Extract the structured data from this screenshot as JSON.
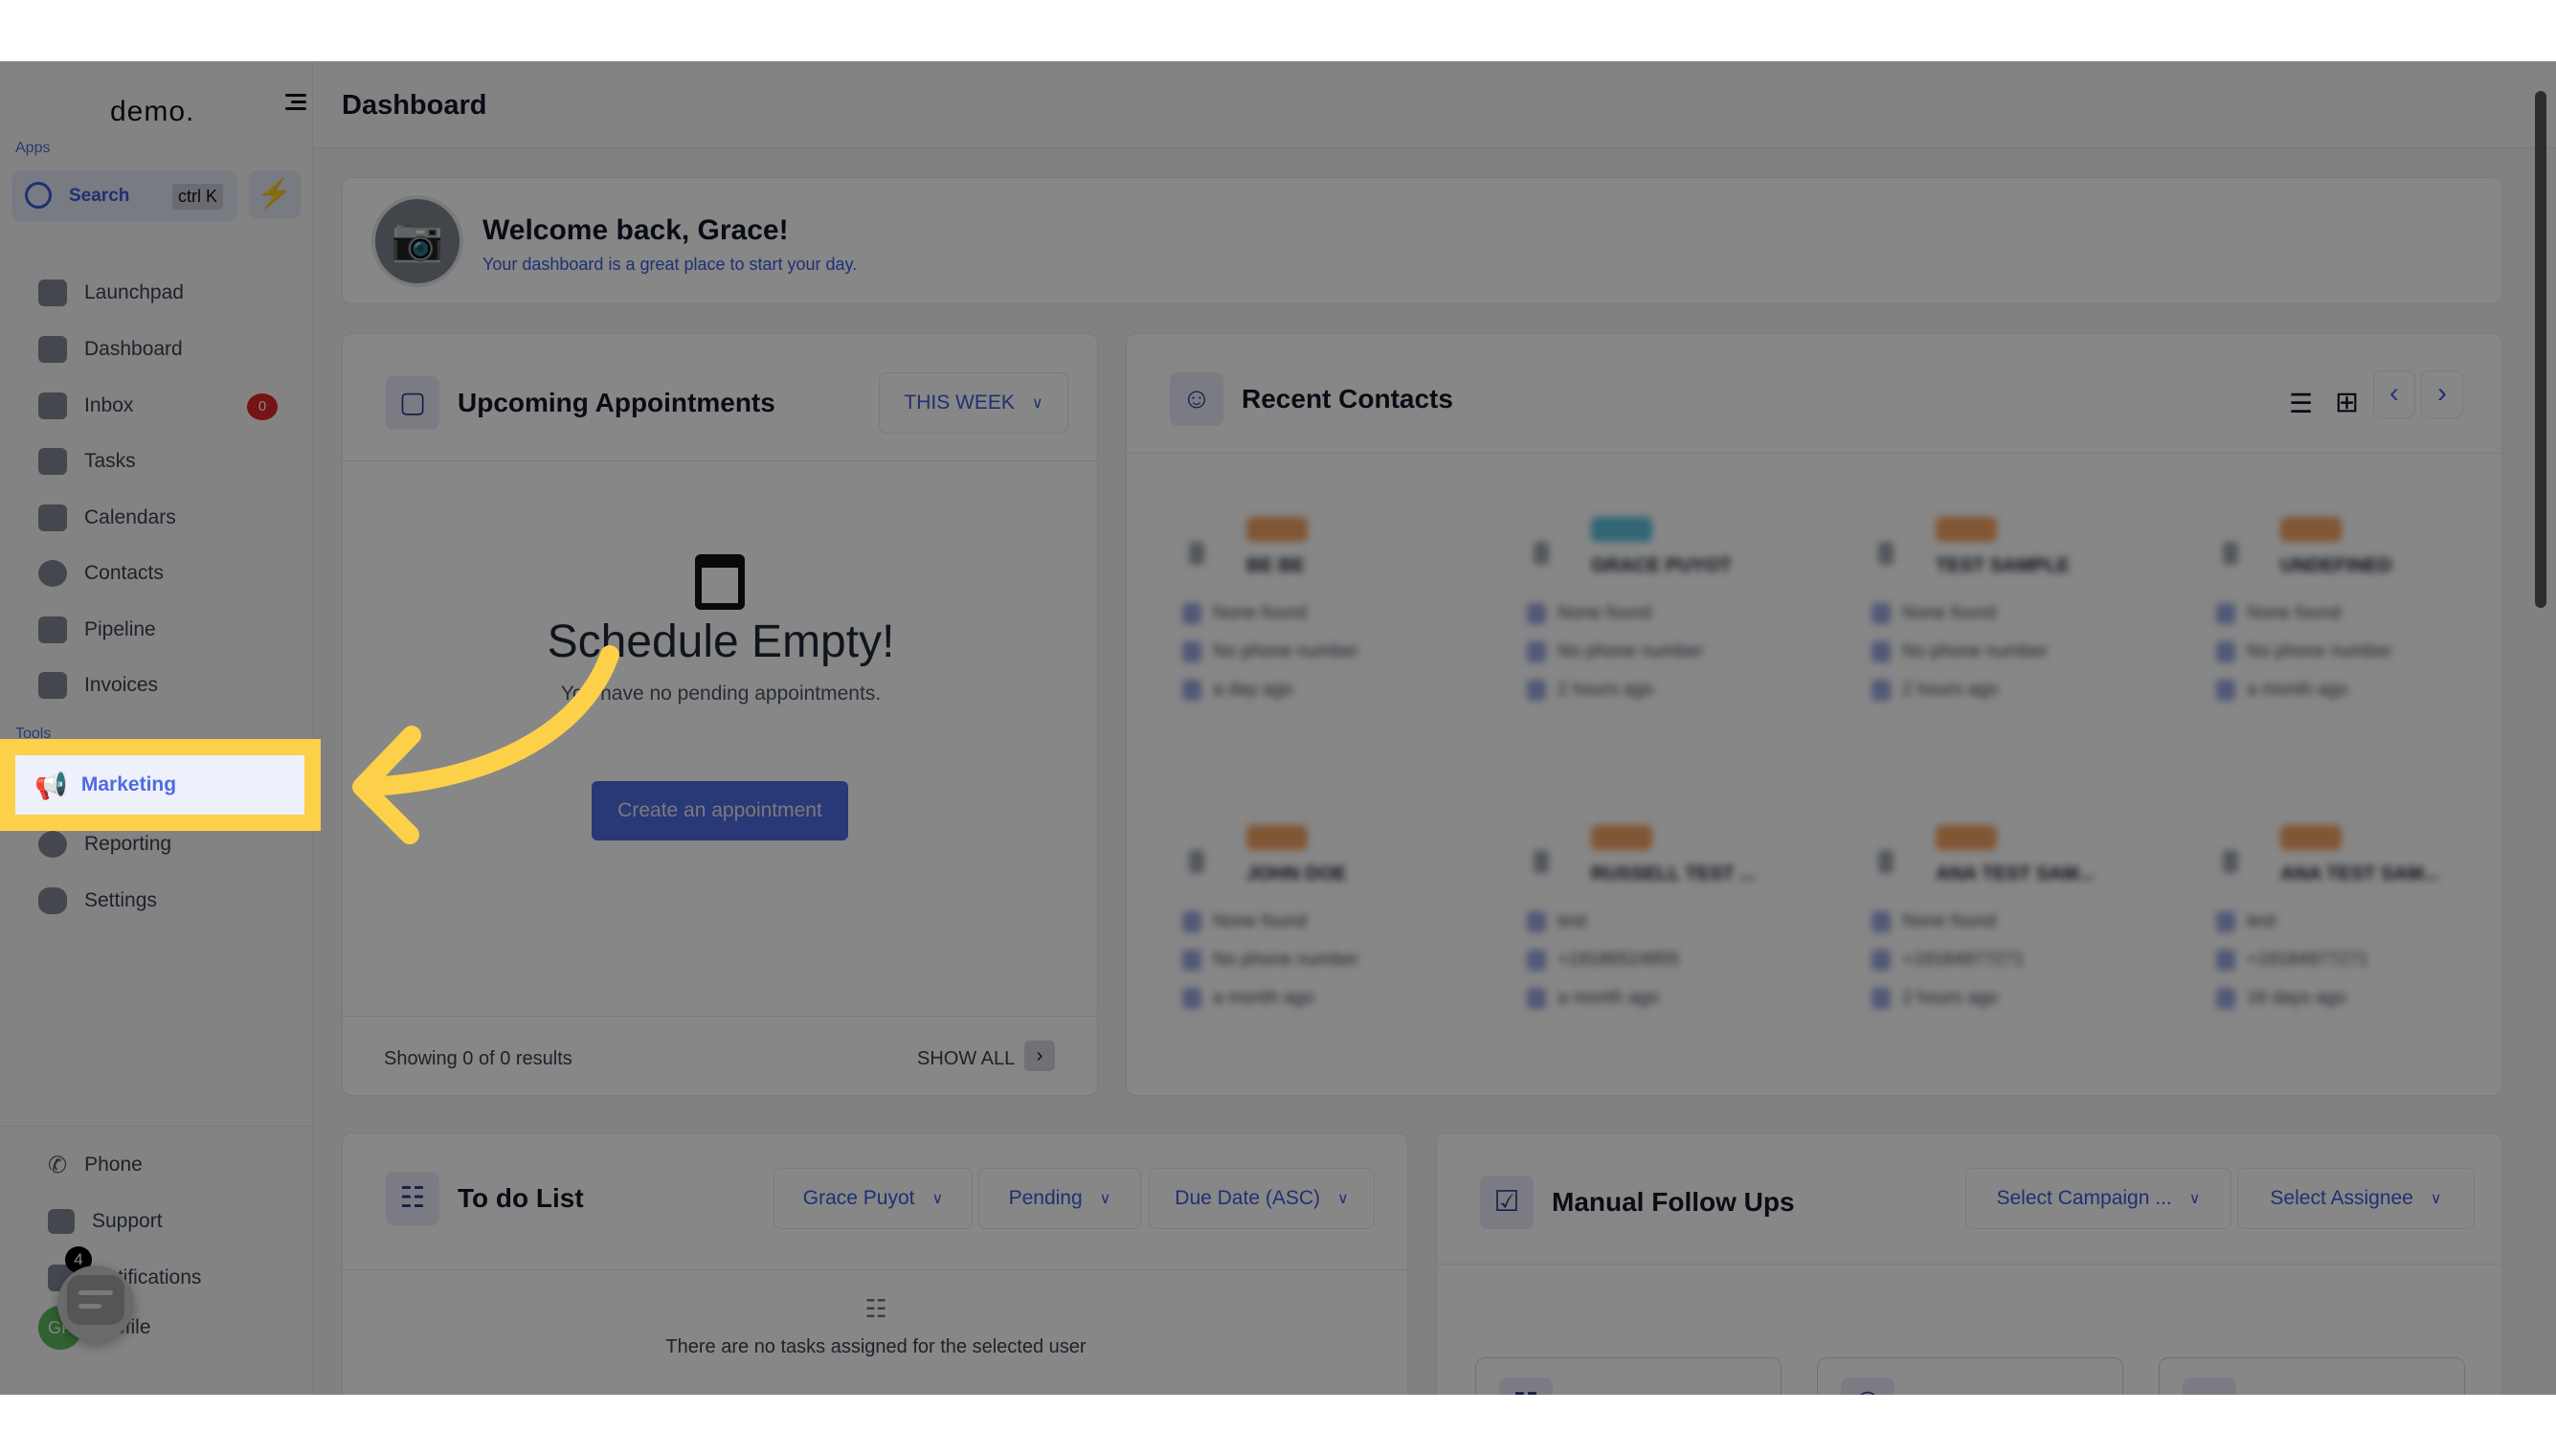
{
  "sidebar": {
    "logo": "demo.",
    "search": {
      "label": "Search",
      "shortcut": "ctrl K"
    },
    "apps_label": "Apps",
    "tools_label": "Tools",
    "apps": [
      {
        "label": "Launchpad",
        "icon": "rocket-icon"
      },
      {
        "label": "Dashboard",
        "icon": "dashboard-icon"
      },
      {
        "label": "Inbox",
        "icon": "inbox-icon",
        "badge": "0"
      },
      {
        "label": "Tasks",
        "icon": "clipboard-icon"
      },
      {
        "label": "Calendars",
        "icon": "calendar-icon"
      },
      {
        "label": "Contacts",
        "icon": "user-icon"
      },
      {
        "label": "Pipeline",
        "icon": "filter-icon"
      },
      {
        "label": "Invoices",
        "icon": "invoice-icon"
      }
    ],
    "tools": [
      {
        "label": "Marketing",
        "icon": "megaphone-icon",
        "highlighted": true
      },
      {
        "label": "Reporting",
        "icon": "pie-chart-icon"
      },
      {
        "label": "Settings",
        "icon": "gear-icon"
      }
    ],
    "bottom": [
      {
        "label": "Phone",
        "icon": "phone-icon"
      },
      {
        "label": "Support",
        "icon": "chat-icon"
      },
      {
        "label": "Notifications",
        "icon": "bell-icon",
        "badge": "4"
      },
      {
        "label": "Profile",
        "avatar": "GP"
      }
    ]
  },
  "header": {
    "title": "Dashboard"
  },
  "welcome": {
    "title": "Welcome back, Grace!",
    "subtitle": "Your dashboard is a great place to start your day."
  },
  "appointments": {
    "title": "Upcoming Appointments",
    "filter": "THIS WEEK",
    "empty_title": "Schedule Empty!",
    "empty_text": "You have no pending appointments.",
    "create_button": "Create an appointment",
    "results": "Showing 0 of 0 results",
    "show_all": "SHOW ALL"
  },
  "recent_contacts": {
    "title": "Recent Contacts",
    "contacts": [
      {
        "name": "BE BE",
        "email": "None found",
        "phone": "No phone number",
        "time": "a day ago"
      },
      {
        "name": "GRACE PUYOT",
        "email": "None found",
        "phone": "No phone number",
        "time": "2 hours ago"
      },
      {
        "name": "TEST SAMPLE",
        "email": "None found",
        "phone": "No phone number",
        "time": "2 hours ago"
      },
      {
        "name": "UNDEFINED",
        "email": "None found",
        "phone": "No phone number",
        "time": "a month ago"
      },
      {
        "name": "JOHN DOE",
        "email": "None found",
        "phone": "No phone number",
        "time": "a month ago"
      },
      {
        "name": "RUSSELL TEST ...",
        "email": "test",
        "phone": "+19186524855",
        "time": "a month ago"
      },
      {
        "name": "ANA TEST SAM...",
        "email": "None found",
        "phone": "+19184977271",
        "time": "2 hours ago"
      },
      {
        "name": "ANA TEST SAM...",
        "email": "test",
        "phone": "+19184977271",
        "time": "16 days ago"
      }
    ]
  },
  "todo": {
    "title": "To do List",
    "filters": [
      "Grace Puyot",
      "Pending",
      "Due Date (ASC)"
    ],
    "empty_text": "There are no tasks assigned for the selected user"
  },
  "followups": {
    "title": "Manual Follow Ups",
    "filters": [
      "Select Campaign ...",
      "Select Assignee"
    ]
  },
  "colors": {
    "accent": "#4f6be0",
    "highlight": "#fdd04a",
    "overlay": "#808080"
  }
}
